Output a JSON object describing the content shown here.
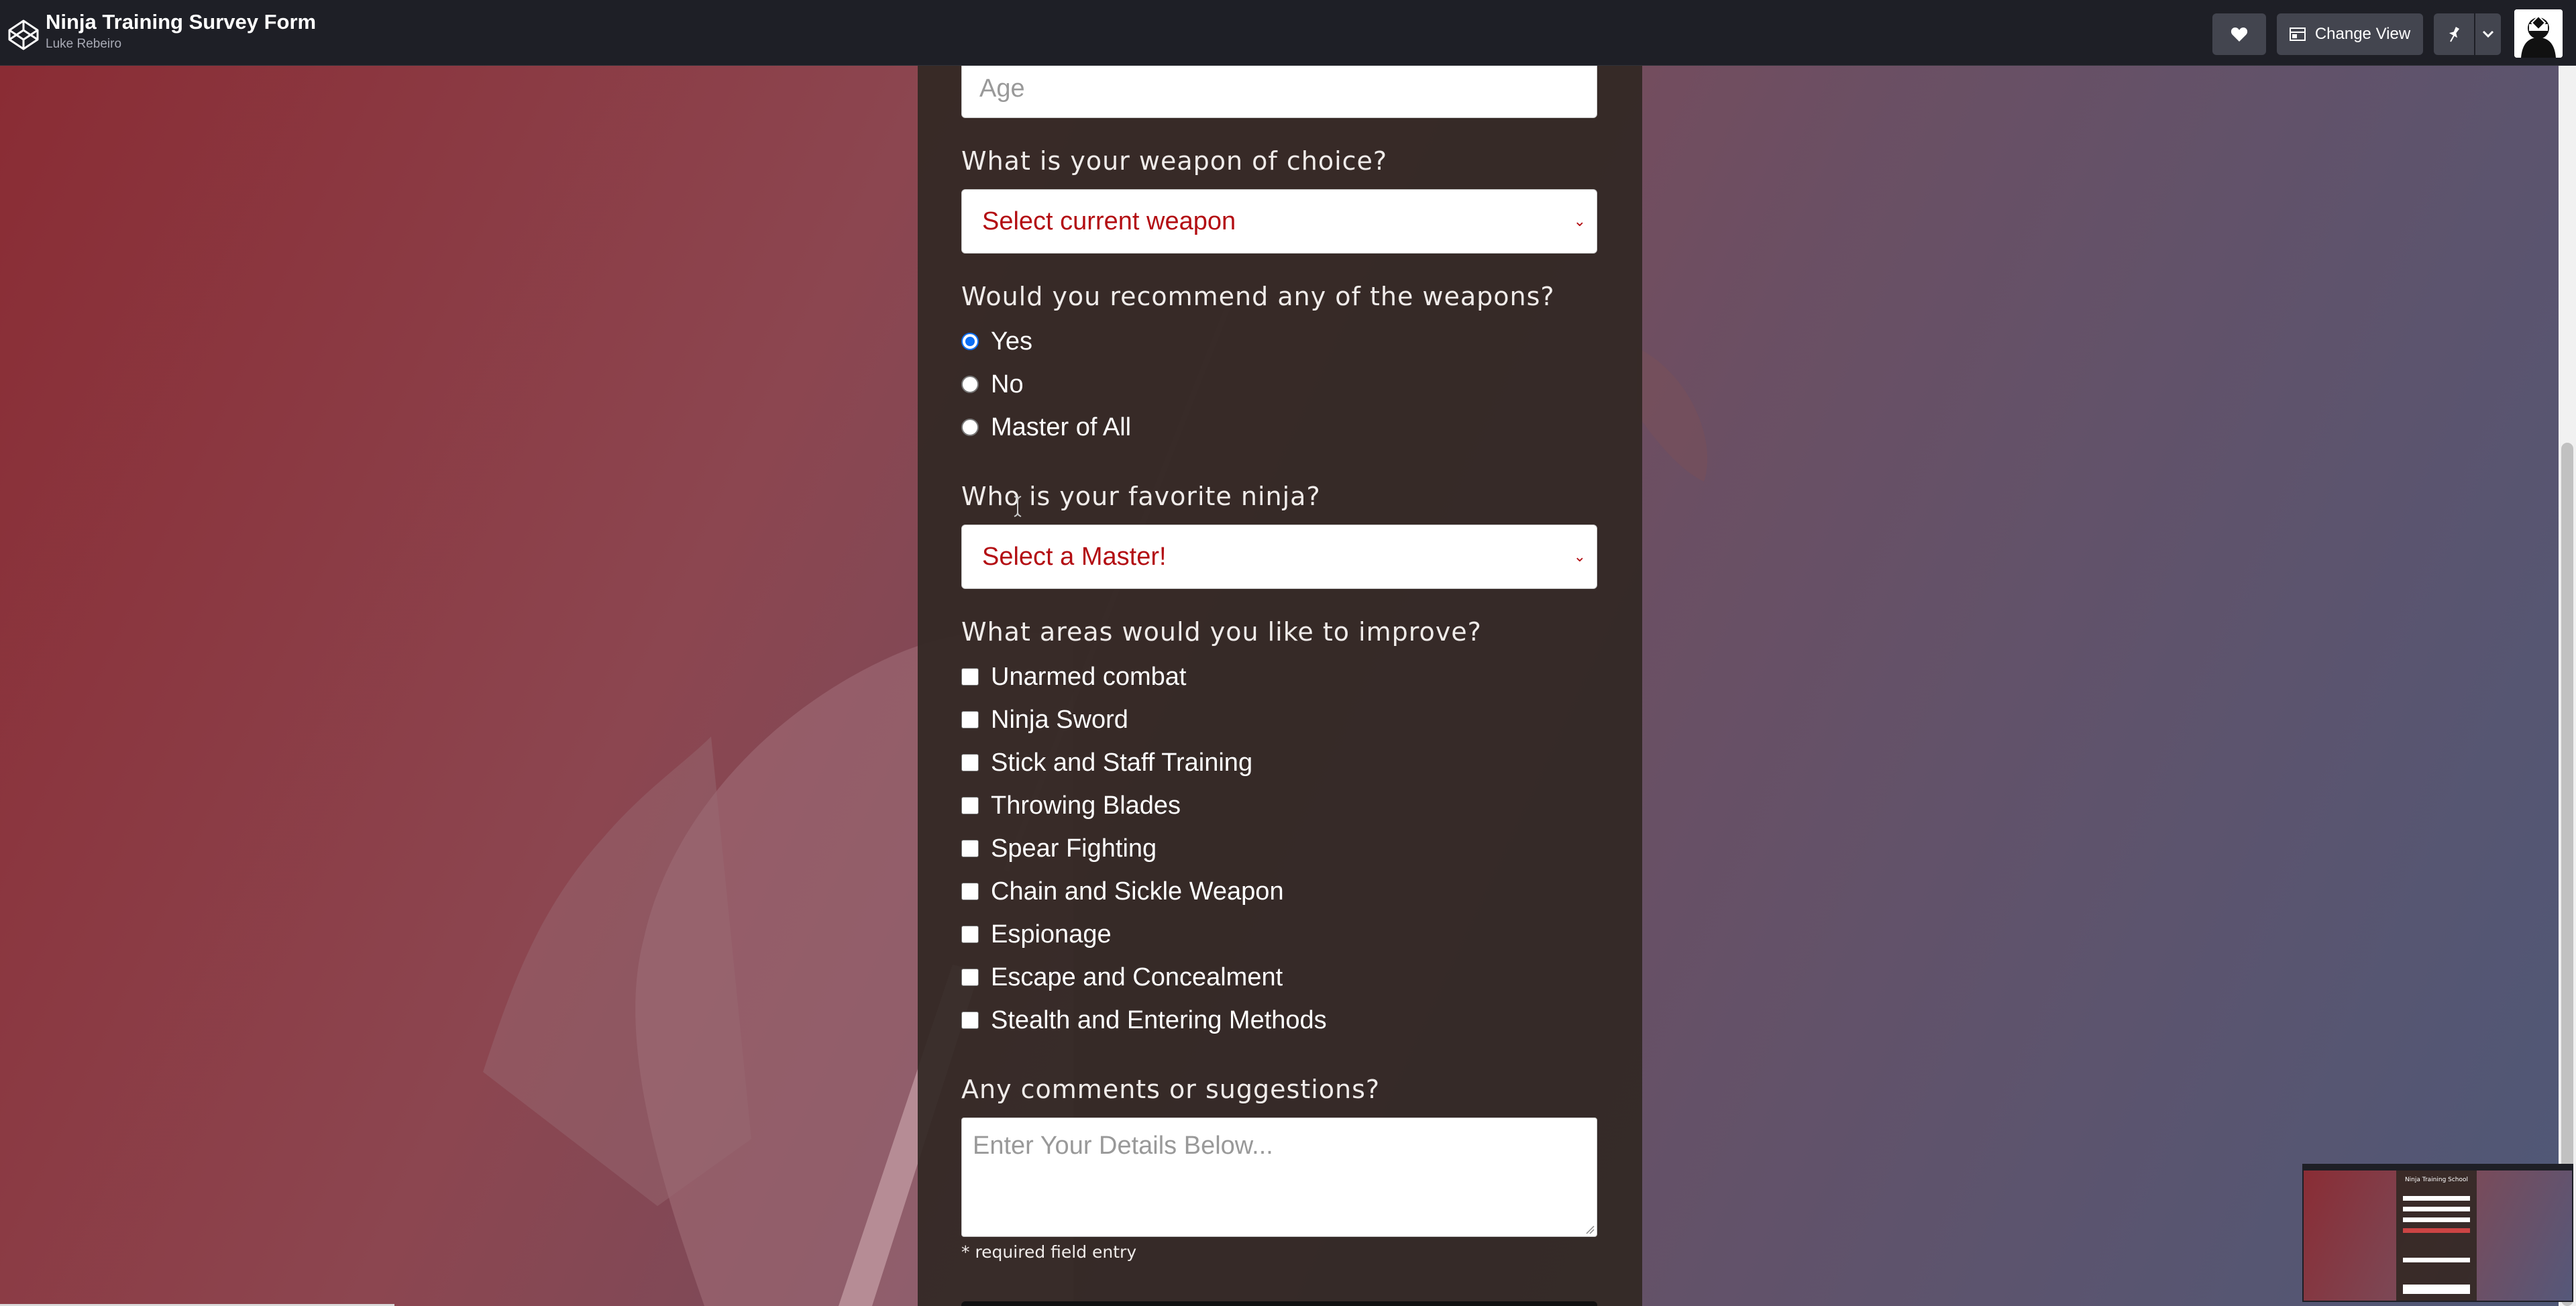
{
  "header": {
    "title": "Ninja Training Survey Form",
    "author": "Luke Rebeiro",
    "change_view_label": "Change View",
    "icons": [
      "codepen-logo-icon",
      "heart-icon",
      "layout-icon",
      "pin-icon",
      "chevron-down-icon",
      "avatar-icon"
    ]
  },
  "form": {
    "age_placeholder": "Age",
    "weapon": {
      "label": "What is your weapon of choice?",
      "selected": "Select current weapon"
    },
    "recommend": {
      "label": "Would you recommend any of the weapons?",
      "options": [
        "Yes",
        "No",
        "Master of All"
      ],
      "selected": "Yes"
    },
    "favorite": {
      "label": "Who is your favorite ninja?",
      "selected": "Select a Master!"
    },
    "improve": {
      "label": "What areas would you like to improve?",
      "options": [
        "Unarmed combat",
        "Ninja Sword",
        "Stick and Staff Training",
        "Throwing Blades",
        "Spear Fighting",
        "Chain and Sickle Weapon",
        "Espionage",
        "Escape and Concealment",
        "Stealth and Entering Methods"
      ]
    },
    "comments": {
      "label": "Any comments or suggestions?",
      "placeholder": "Enter Your Details Below..."
    },
    "required_note": "* required field entry"
  },
  "preview": {
    "title": "Ninja Training School"
  },
  "colors": {
    "topbar": "#1e1f26",
    "button": "#43454f",
    "select_text": "#b30d12",
    "radio_accent": "#0b6ff5",
    "panel": "#322824"
  }
}
